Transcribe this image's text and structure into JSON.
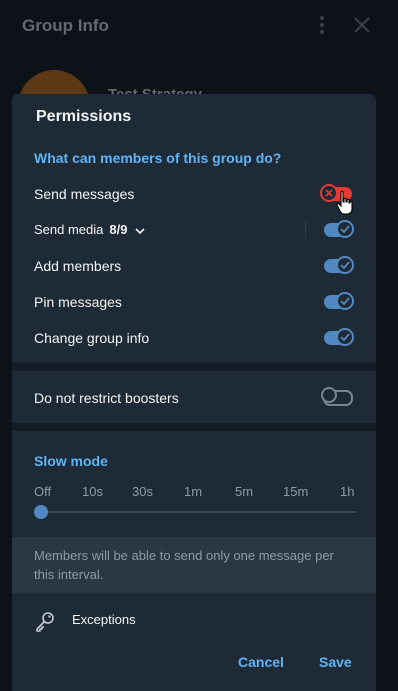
{
  "background": {
    "title": "Group Info",
    "group_name": "Test Strategy"
  },
  "dialog": {
    "title": "Permissions",
    "section_members": "What can members of this group do?",
    "permissions": [
      {
        "label": "Send messages",
        "state": "restricted"
      },
      {
        "label": "Send media",
        "counter": "8/9",
        "state": "on"
      },
      {
        "label": "Add members",
        "state": "on"
      },
      {
        "label": "Pin messages",
        "state": "on"
      },
      {
        "label": "Change group info",
        "state": "on"
      }
    ],
    "boosters": {
      "label": "Do not restrict boosters",
      "state": "off"
    },
    "slow_mode": {
      "title": "Slow mode",
      "options": [
        "Off",
        "10s",
        "30s",
        "1m",
        "5m",
        "15m",
        "1h"
      ],
      "selected": "Off",
      "info": "Members will be able to send only one message per this interval."
    },
    "exceptions_label": "Exceptions",
    "cancel_label": "Cancel",
    "save_label": "Save"
  },
  "colors": {
    "accent": "#5eb5f7",
    "toggle_on": "#5288c1",
    "toggle_restricted": "#e53935",
    "dialog_bg": "#1e2a35"
  }
}
